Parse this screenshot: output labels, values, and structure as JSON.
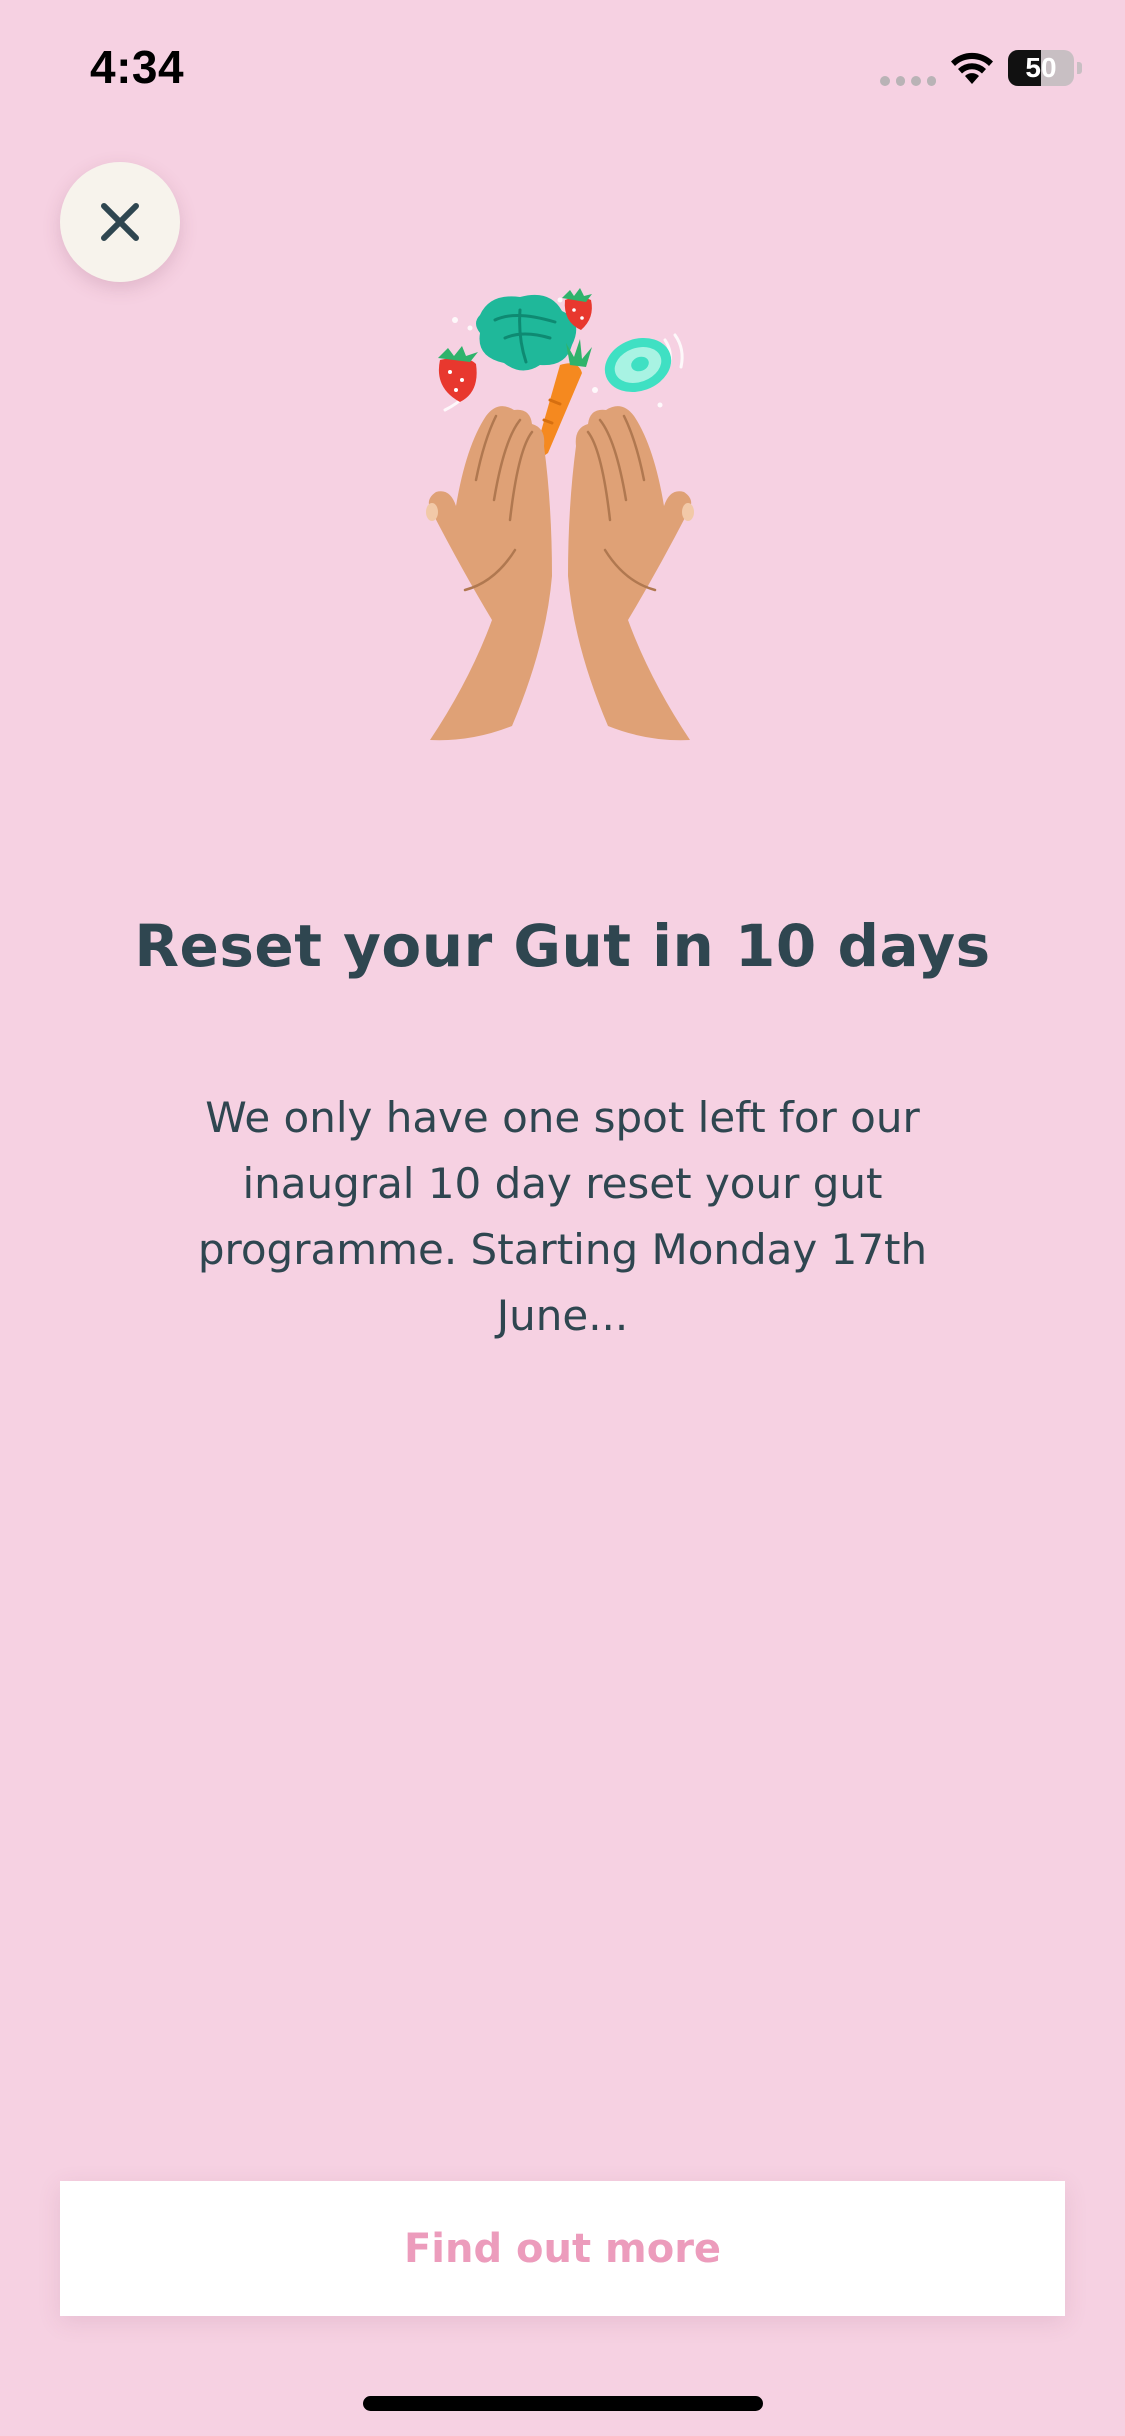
{
  "status_bar": {
    "time": "4:34",
    "battery_level": "50",
    "battery_fraction": 0.5,
    "signal_icon": "cellular-signal-icon",
    "wifi_icon": "wifi-icon"
  },
  "header": {
    "close_icon": "close-icon"
  },
  "illustration": {
    "name": "hands-tossing-vegetables-illustration"
  },
  "content": {
    "title": "Reset your Gut in 10 days",
    "body": "We only have one spot left for our inaugral 10 day reset your gut programme. Starting Monday 17th June..."
  },
  "cta": {
    "label": "Find out more"
  },
  "colors": {
    "background": "#f6d1e2",
    "text": "#2f4650",
    "cta_text": "#ec9cbc",
    "cta_background": "#ffffff"
  }
}
